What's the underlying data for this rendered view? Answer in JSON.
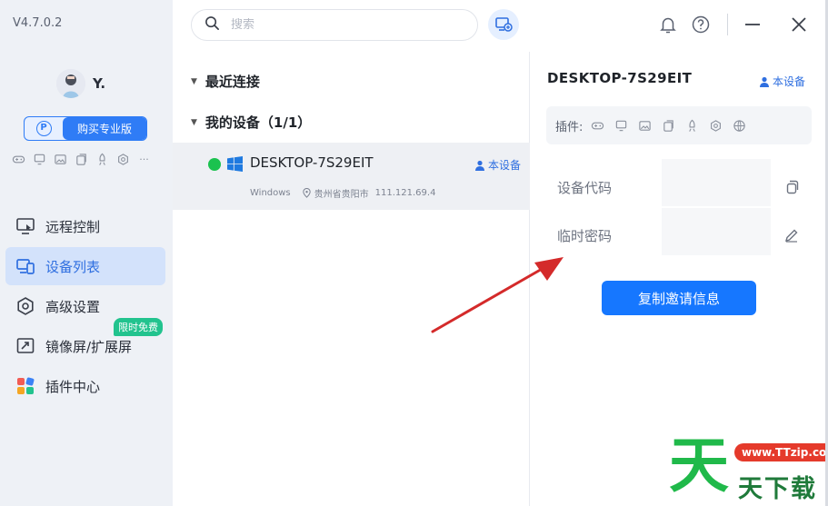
{
  "app": {
    "version": "V4.7.0.2"
  },
  "user": {
    "name": "Y."
  },
  "sidebar": {
    "buy_pro_label": "购买专业版",
    "pro_icon_letter": "P",
    "plugin_icons": [
      "gamepad-icon",
      "screen-icon",
      "image-icon",
      "copy-icon",
      "rocket-icon",
      "camera-icon",
      "more-icon"
    ],
    "more_label": "···",
    "nav": [
      {
        "label": "远程控制",
        "icon": "remote-control-icon",
        "active": false
      },
      {
        "label": "设备列表",
        "icon": "device-list-icon",
        "active": true
      },
      {
        "label": "高级设置",
        "icon": "settings-hexagon-icon",
        "active": false
      },
      {
        "label": "镜像屏/扩展屏",
        "icon": "mirror-screen-icon",
        "active": false,
        "badge": "限时免费"
      },
      {
        "label": "插件中心",
        "icon": "plugin-center-icon",
        "active": false
      }
    ]
  },
  "search": {
    "placeholder": "搜索"
  },
  "device_list": {
    "groups": [
      {
        "label": "最近连接",
        "expanded": true
      },
      {
        "label": "我的设备（1/1）",
        "expanded": true
      }
    ],
    "devices": [
      {
        "name": "DESKTOP-7S29EIT",
        "status": "online",
        "os": "Windows",
        "location": "贵州省贵阳市",
        "ip": "111.121.69.4",
        "tag": "本设备"
      }
    ]
  },
  "detail": {
    "title": "DESKTOP-7S29EIT",
    "tag": "本设备",
    "plugins_label": "插件:",
    "plugin_icons": [
      "gamepad-icon",
      "screen-icon",
      "image-icon",
      "copy-icon",
      "rocket-icon",
      "camera-icon",
      "globe-icon"
    ],
    "device_code_label": "设备代码",
    "temp_password_label": "临时密码",
    "copy_invite_label": "复制邀请信息"
  },
  "watermark": {
    "big": "天",
    "url": "www.TTzip.com",
    "small": "天下载"
  },
  "colors": {
    "accent": "#1677ff",
    "online": "#1bc24f",
    "badge": "#22c38e",
    "arrow": "#d42a2a"
  }
}
